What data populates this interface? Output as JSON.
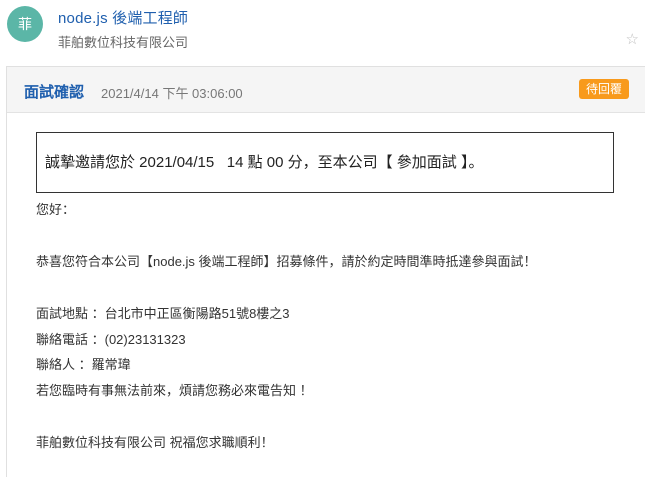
{
  "header": {
    "avatar_text": "菲",
    "job_title": "node.js 後端工程師",
    "company": "菲舶數位科技有限公司",
    "star_icon": "☆"
  },
  "card": {
    "title": "面試確認",
    "time": "2021/4/14 下午 03:06:00",
    "status": "待回覆",
    "status_color": "#f89a1c",
    "invite": "誠摯邀請您於 2021/04/15   14 點 00 分，至本公司【 參加面試 】。",
    "greeting": "您好：",
    "congrats": "恭喜您符合本公司【node.js 後端工程師】招募條件，請於約定時間準時抵達參與面試！",
    "location": "面試地點 ：台北市中正區衡陽路51號8樓之3",
    "phone": "聯絡電話 ：(02)23131323",
    "contact": "聯絡人 ：羅常瑋",
    "notice": "若您臨時有事無法前來，煩請您務必來電告知 ！",
    "closing": "菲舶數位科技有限公司 祝福您求職順利！"
  }
}
